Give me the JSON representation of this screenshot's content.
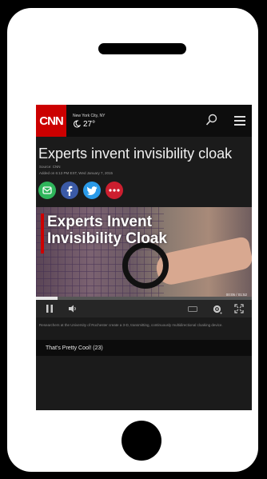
{
  "topbar": {
    "logo_text": "CNN",
    "weather_city": "New York City, NY",
    "weather_temp": "27°"
  },
  "article": {
    "headline": "Experts invent invisibility cloak",
    "source": "Source: CNN",
    "added": "Added on 6:13 PM EST, Wed January 7, 2015",
    "caption": "Researchers at the University of Rochester create a 3-D, transmitting, continuously multidirectional cloaking device."
  },
  "share": [
    "message-icon",
    "facebook-icon",
    "twitter-icon",
    "more-icon"
  ],
  "share_colors": {
    "message": "#2fb55b",
    "facebook": "#3b5aa6",
    "twitter": "#2a9ae8",
    "more": "#cc1f2f"
  },
  "video": {
    "title_line1": "Experts Invent",
    "title_line2": "Invisibility Cloak",
    "time": "00:05 / 01:52",
    "progress_fraction": 0.1
  },
  "comments": {
    "label": "That's Pretty Cool! (23)"
  }
}
